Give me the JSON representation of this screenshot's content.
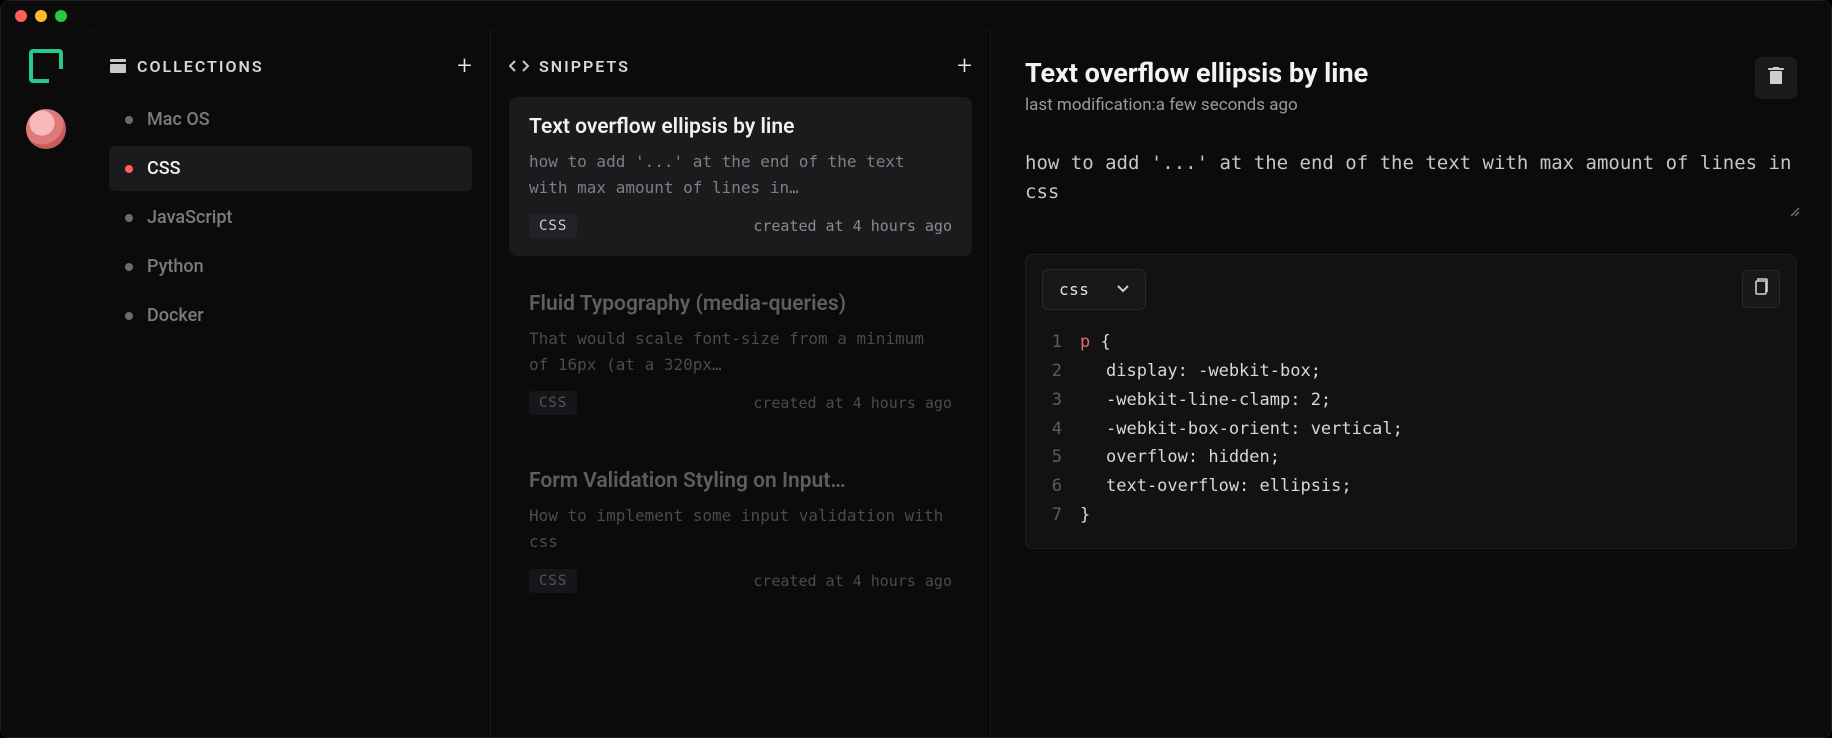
{
  "collections": {
    "title": "COLLECTIONS",
    "items": [
      {
        "name": "Mac OS",
        "active": false
      },
      {
        "name": "CSS",
        "active": true
      },
      {
        "name": "JavaScript",
        "active": false
      },
      {
        "name": "Python",
        "active": false
      },
      {
        "name": "Docker",
        "active": false
      }
    ]
  },
  "snippets": {
    "title": "SNIPPETS",
    "items": [
      {
        "title": "Text overflow ellipsis by line",
        "desc": "how to add '...' at the end of the text with max amount of lines in…",
        "tag": "CSS",
        "created": "created at 4 hours ago",
        "active": true
      },
      {
        "title": "Fluid Typography (media-queries)",
        "desc": "That would scale font-size from a minimum of 16px (at a 320px…",
        "tag": "CSS",
        "created": "created at 4 hours ago",
        "active": false
      },
      {
        "title": "Form Validation Styling on Input…",
        "desc": "How to implement some input validation with css",
        "tag": "CSS",
        "created": "created at 4 hours ago",
        "active": false
      }
    ]
  },
  "detail": {
    "title": "Text overflow ellipsis by line",
    "sub_prefix": "last modification:",
    "sub_value": "a few seconds ago",
    "desc": "how to add '...' at the end of the text with max amount of lines in css",
    "lang": "css",
    "code": [
      {
        "n": "1",
        "sel": "p",
        "rest": " {"
      },
      {
        "n": "2",
        "indent": true,
        "rest": "display: -webkit-box;"
      },
      {
        "n": "3",
        "indent": true,
        "rest": "-webkit-line-clamp: 2;"
      },
      {
        "n": "4",
        "indent": true,
        "rest": "-webkit-box-orient: vertical;"
      },
      {
        "n": "5",
        "indent": true,
        "rest": "overflow: hidden;"
      },
      {
        "n": "6",
        "indent": true,
        "rest": "text-overflow: ellipsis;"
      },
      {
        "n": "7",
        "rest": "}"
      }
    ]
  }
}
